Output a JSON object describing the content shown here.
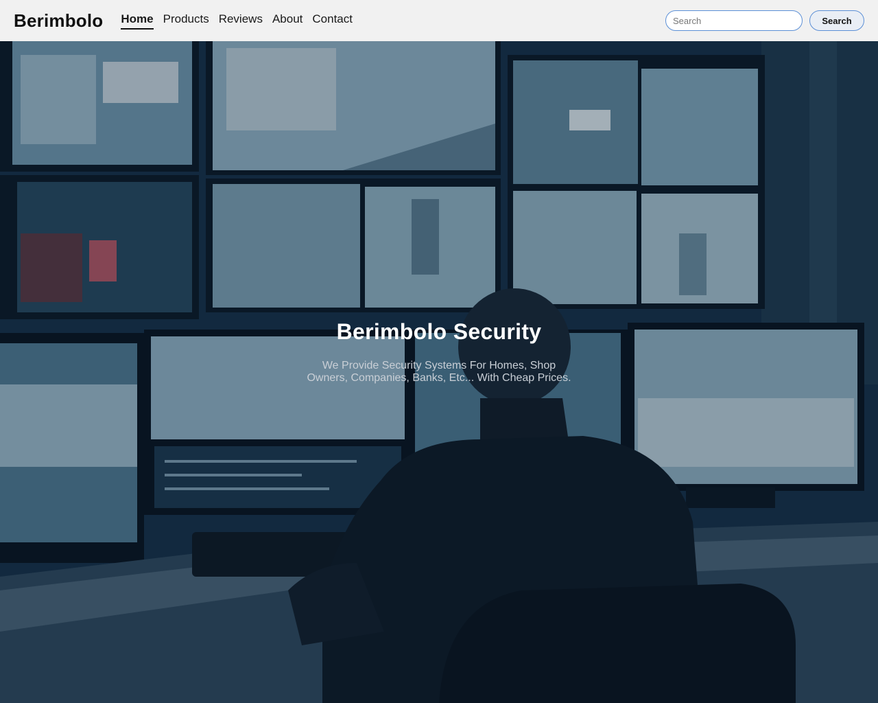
{
  "brand": "Berimbolo",
  "nav": {
    "items": [
      {
        "label": "Home",
        "active": true
      },
      {
        "label": "Products",
        "active": false
      },
      {
        "label": "Reviews",
        "active": false
      },
      {
        "label": "About",
        "active": false
      },
      {
        "label": "Contact",
        "active": false
      }
    ]
  },
  "search": {
    "placeholder": "Search",
    "value": "",
    "button_label": "Search"
  },
  "hero": {
    "title": "Berimbolo Security",
    "subtitle": "We Provide Security Systems For Homes, Shop Owners, Companies, Banks, Etc... With Cheap Prices.",
    "image_icon": "security-control-room-image"
  },
  "colors": {
    "navbar_bg": "#f1f1f1",
    "search_border": "#5b8fd6",
    "hero_title": "#ffffff",
    "hero_subtitle": "#c9cfd6"
  }
}
